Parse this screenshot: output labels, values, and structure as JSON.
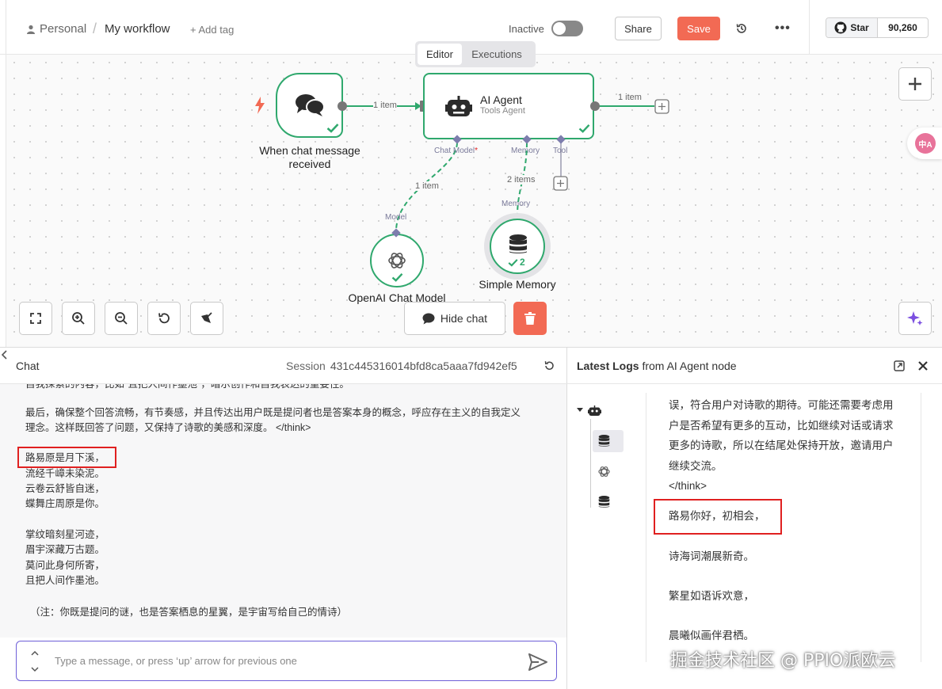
{
  "header": {
    "breadcrumb_user": "Personal",
    "breadcrumb_sep": "/",
    "workflow_name": "My workflow",
    "add_tag": "+ Add tag",
    "status_label": "Inactive",
    "share_label": "Share",
    "save_label": "Save",
    "github_star": "Star",
    "github_count": "90,260"
  },
  "canvas": {
    "tabs": [
      {
        "label": "Editor"
      },
      {
        "label": "Executions"
      }
    ],
    "nodes": {
      "trigger": {
        "label_line1": "When chat message",
        "label_line2": "received"
      },
      "agent": {
        "title": "AI Agent",
        "subtitle": "Tools Agent"
      },
      "model": {
        "label": "OpenAI Chat Model"
      },
      "memory": {
        "label": "Simple Memory",
        "badge": "2"
      }
    },
    "port_labels": {
      "chat_model": "Chat Model",
      "required_mark": "*",
      "memory": "Memory",
      "tool": "Tool",
      "model_in": "Model",
      "memory_in": "Memory"
    },
    "edges": {
      "trigger_to_agent": "1 item",
      "agent_out": "1 item",
      "model_link": "1 item",
      "memory_link": "2 items"
    },
    "hide_chat_label": "Hide chat",
    "translate_badge": "中A"
  },
  "chat": {
    "title": "Chat",
    "session_label": "Session",
    "session_id": "431c445316014bfd8ca5aaa7fd942ef5",
    "lines": [
      {
        "text": "自我探索的内容，比如\"且把人间作墨池\"，暗示创作和自我表达的重要性。"
      },
      {
        "text": "最后，确保整个回答流畅，有节奏感，并且传达出用户既是提问者也是答案本身的概念，呼应存在主义的自我定义"
      },
      {
        "text": "理念。这样既回答了问题，又保持了诗歌的美感和深度。 </think>"
      },
      {
        "text": "路易原是月下溪，"
      },
      {
        "text": "流经千嶂未染泥。"
      },
      {
        "text": "云卷云舒皆自迷，"
      },
      {
        "text": "蝶舞庄周原是你。"
      },
      {
        "text": "掌纹暗刻星河迹，"
      },
      {
        "text": "眉宇深藏万古题。"
      },
      {
        "text": "莫问此身何所寄，"
      },
      {
        "text": "且把人间作墨池。"
      },
      {
        "text": "（注：你既是提问的谜，也是答案栖息的星翼，是宇宙写给自己的情诗）"
      }
    ],
    "input_placeholder": "Type a message, or press ‘up’ arrow for previous one"
  },
  "logs": {
    "title_bold": "Latest Logs",
    "title_rest": " from AI Agent node",
    "lines": [
      {
        "text": "误，符合用户对诗歌的期待。可能还需要考虑用"
      },
      {
        "text": "户是否希望有更多的互动，比如继续对话或请求"
      },
      {
        "text": "更多的诗歌，所以在结尾处保持开放，邀请用户"
      },
      {
        "text": "继续交流。"
      },
      {
        "text": "</think>"
      },
      {
        "text": "路易你好，初相会，"
      },
      {
        "text": "诗海词潮展新奇。"
      },
      {
        "text": "繁星如语诉欢意，"
      },
      {
        "text": "晨曦似画伴君栖。"
      }
    ]
  },
  "watermark": "掘金技术社区 @ PPIO派欧云",
  "colors": {
    "accent_green": "#2fa86d",
    "save_red": "#f26a54",
    "input_border": "#6e5fd8",
    "highlight_red": "#e02020"
  }
}
